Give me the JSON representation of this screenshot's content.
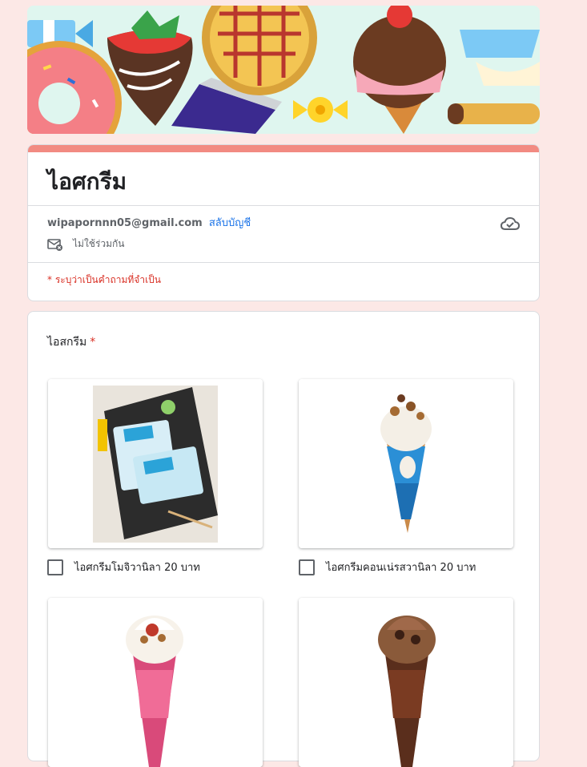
{
  "form": {
    "title": "ไอศกรีม",
    "account_email": "wipapornnn05@gmail.com",
    "switch_account": "สลับบัญชี",
    "not_shared": "ไม่ใช้ร่วมกัน",
    "required_note": "* ระบุว่าเป็นคำถามที่จำเป็น"
  },
  "question": {
    "title": "ไอสกรีม",
    "required_mark": "*",
    "options": [
      {
        "label": "ไอศกรีมโมจิวานิลา 20 บาท",
        "checked": false
      },
      {
        "label": "ไอศกรีมคอนเน่รสวานิลา 20 บาท",
        "checked": false
      },
      {
        "label": "",
        "checked": false
      },
      {
        "label": "",
        "checked": false
      }
    ]
  },
  "colors": {
    "background": "#fce8e6",
    "accent": "#f28b82",
    "link": "#1a73e8",
    "required": "#d93025"
  }
}
